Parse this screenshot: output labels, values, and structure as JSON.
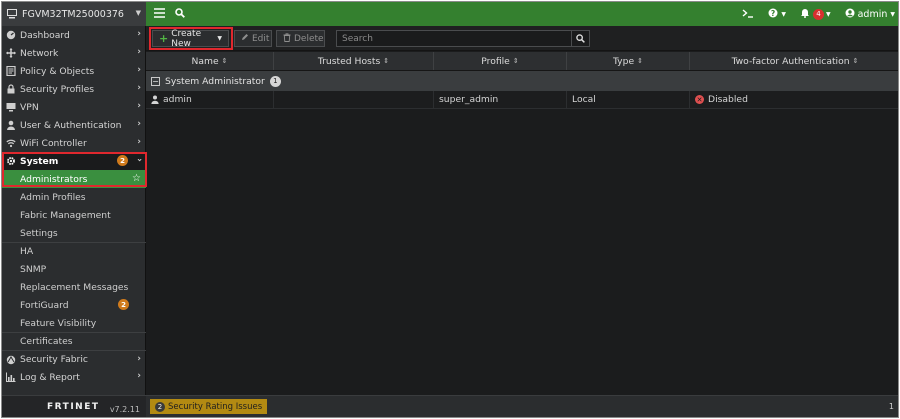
{
  "device": {
    "name": "FGVM32TM25000376"
  },
  "sidebar": {
    "items": [
      {
        "label": "Dashboard",
        "icon": "dashboard-icon"
      },
      {
        "label": "Network",
        "icon": "network-icon"
      },
      {
        "label": "Policy & Objects",
        "icon": "policy-icon"
      },
      {
        "label": "Security Profiles",
        "icon": "lock-icon"
      },
      {
        "label": "VPN",
        "icon": "monitor-icon"
      },
      {
        "label": "User & Authentication",
        "icon": "user-icon"
      },
      {
        "label": "WiFi Controller",
        "icon": "wifi-icon"
      }
    ],
    "system": {
      "label": "System",
      "badge": "2"
    },
    "system_subitems": [
      {
        "label": "Administrators"
      },
      {
        "label": "Admin Profiles"
      },
      {
        "label": "Fabric Management"
      },
      {
        "label": "Settings"
      },
      {
        "label": "HA"
      },
      {
        "label": "SNMP"
      },
      {
        "label": "Replacement Messages"
      },
      {
        "label": "FortiGuard",
        "badge": "2"
      },
      {
        "label": "Feature Visibility"
      },
      {
        "label": "Certificates"
      }
    ],
    "bottom_items": [
      {
        "label": "Security Fabric",
        "icon": "fabric-icon"
      },
      {
        "label": "Log & Report",
        "icon": "chart-icon"
      }
    ],
    "brand": "F⁠RTINET",
    "version": "v7.2.11"
  },
  "topbar": {
    "notifications_count": "4",
    "user": "admin"
  },
  "toolbar": {
    "create_label": "Create New",
    "edit_label": "Edit",
    "delete_label": "Delete",
    "search_placeholder": "Search"
  },
  "table": {
    "columns": [
      "Name",
      "Trusted Hosts",
      "Profile",
      "Type",
      "Two-factor Authentication"
    ],
    "group": {
      "label": "System Administrator",
      "count": "1"
    },
    "rows": [
      {
        "name": "admin",
        "trusted_hosts": "",
        "profile": "super_admin",
        "type": "Local",
        "two_factor": "Disabled"
      }
    ]
  },
  "bottombar": {
    "rating_count": "2",
    "rating_label": "Security Rating Issues",
    "page_count": "1"
  },
  "colors": {
    "topbar": "#34802f",
    "active": "#3a8f3f",
    "highlight": "#e0282e",
    "badge": "#d07b1c"
  }
}
